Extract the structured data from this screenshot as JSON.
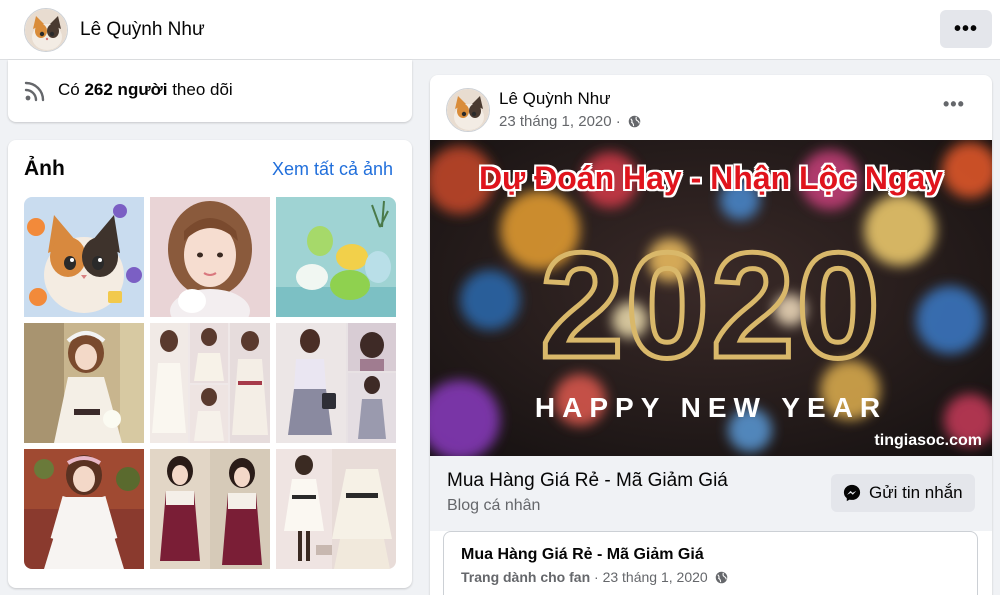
{
  "header": {
    "profile_name": "Lê Quỳnh Như",
    "more_label": "•••"
  },
  "followers": {
    "prefix": "Có",
    "count": "262 người",
    "suffix": "theo dõi"
  },
  "photos": {
    "title": "Ảnh",
    "see_all_label": "Xem tất cả ảnh",
    "items": [
      "kitten-photo",
      "girl-portrait-photo",
      "easter-eggs-photo",
      "white-dress-photo",
      "dress-collage-photo",
      "outfit-collage-photo",
      "lace-dress-photo",
      "burgundy-dress-photo",
      "boutique-dress-photo"
    ]
  },
  "post": {
    "author": "Lê Quỳnh Như",
    "date": "23 tháng 1, 2020",
    "separator": "·",
    "more_label": "•••",
    "banner": {
      "headline": "Dự Đoán Hay - Nhận Lộc Ngay",
      "year": "2020",
      "tagline": "HAPPY NEW YEAR",
      "site": "tingiasoc.com"
    },
    "page": {
      "name": "Mua Hàng Giá Rẻ - Mã Giảm Giá",
      "category": "Blog cá nhân",
      "message_button": "Gửi tin nhắn"
    },
    "shared": {
      "name": "Mua Hàng Giá Rẻ - Mã Giảm Giá",
      "type": "Trang dành cho fan",
      "separator": "·",
      "date": "23 tháng 1, 2020"
    }
  },
  "colors": {
    "link": "#216fdb",
    "background": "#f0f2f5",
    "secondary_text": "#65676b",
    "headline_red": "#e0141d",
    "gold": "#d9b86a"
  }
}
